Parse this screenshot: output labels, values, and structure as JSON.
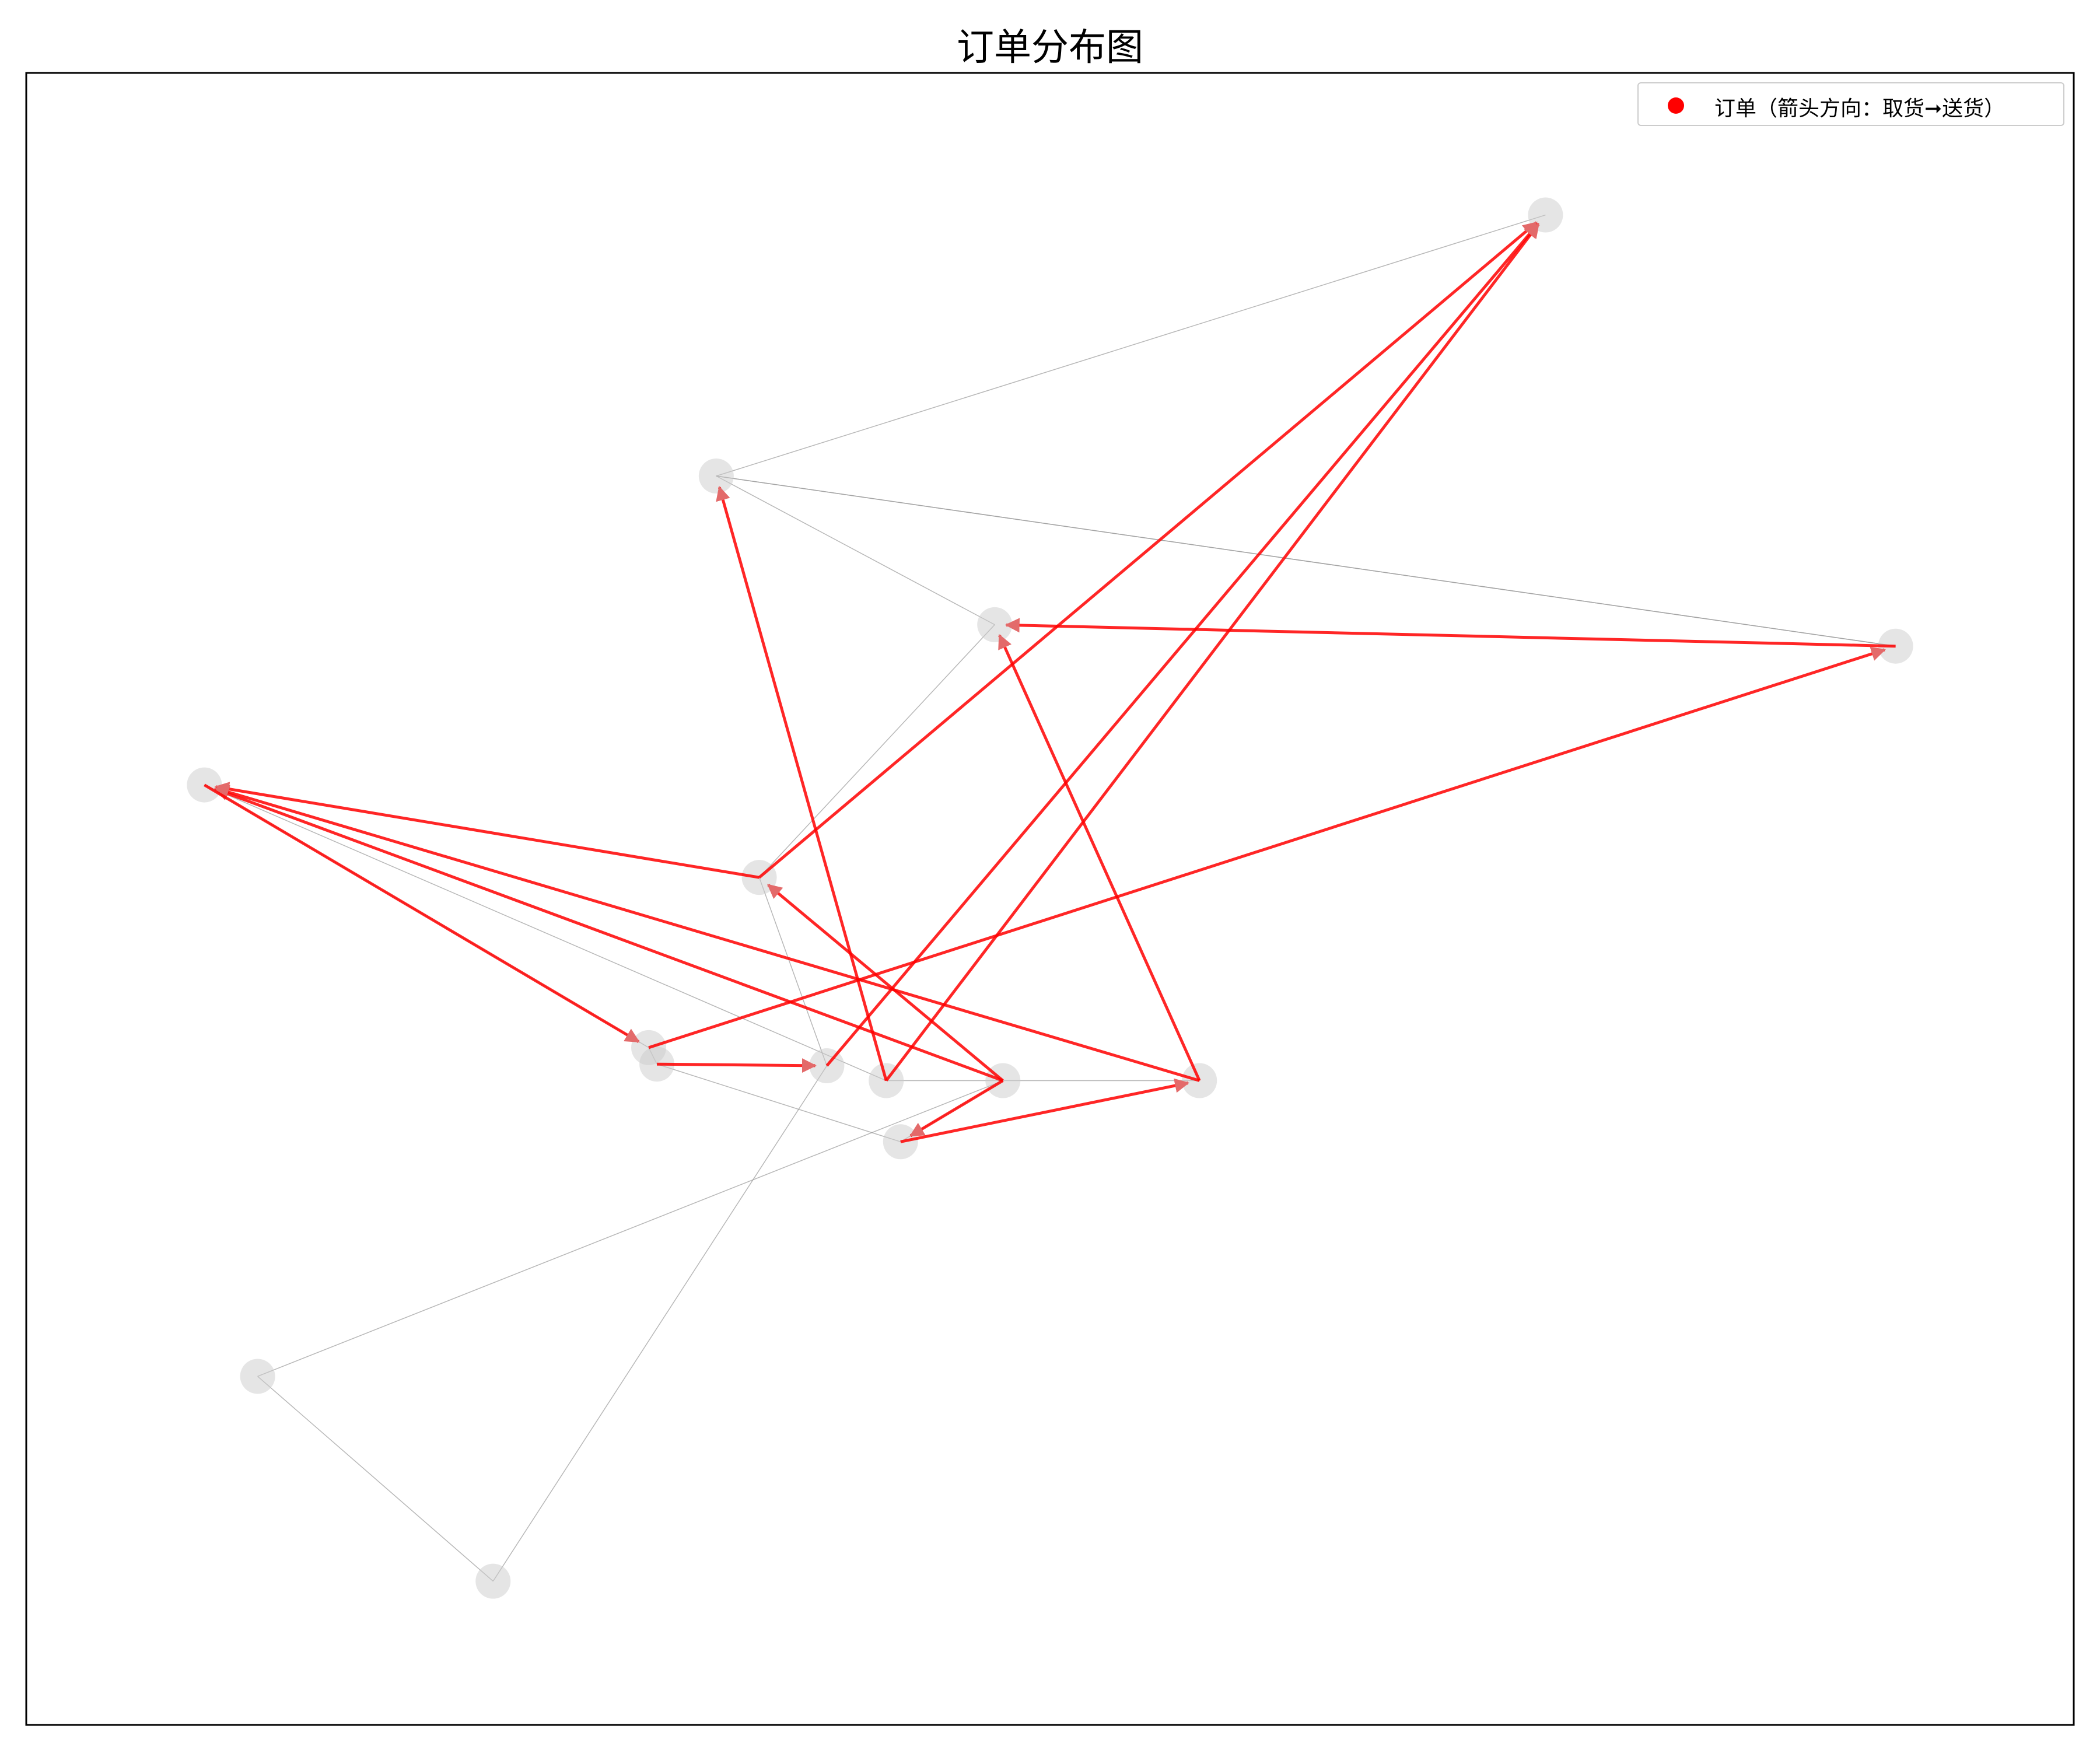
{
  "chart_data": {
    "type": "scatter",
    "title": "订单分布图",
    "xlabel": "",
    "ylabel": "",
    "xlim": [
      0,
      100
    ],
    "ylim": [
      0,
      100
    ],
    "grid": false,
    "axes_ticks": false,
    "legend": {
      "placement": "top-right",
      "label": "订单（箭头方向：取货➞送货）"
    },
    "colors": {
      "arrow": "#ff0000",
      "node": "#cccccc",
      "route": "#999999",
      "legend_marker": "#ff0000"
    },
    "nodes": [
      {
        "id": "A",
        "x": 74.2,
        "y": 91.4
      },
      {
        "id": "B",
        "x": 33.7,
        "y": 75.6
      },
      {
        "id": "C",
        "x": 47.3,
        "y": 66.6
      },
      {
        "id": "D",
        "x": 91.3,
        "y": 65.3
      },
      {
        "id": "E",
        "x": 8.7,
        "y": 56.9
      },
      {
        "id": "F",
        "x": 35.8,
        "y": 51.3
      },
      {
        "id": "G",
        "x": 30.4,
        "y": 41.0
      },
      {
        "id": "H",
        "x": 30.8,
        "y": 40.0
      },
      {
        "id": "I",
        "x": 39.1,
        "y": 39.9
      },
      {
        "id": "J",
        "x": 42.0,
        "y": 39.0
      },
      {
        "id": "K",
        "x": 47.7,
        "y": 39.0
      },
      {
        "id": "L",
        "x": 57.3,
        "y": 39.0
      },
      {
        "id": "M",
        "x": 42.7,
        "y": 35.3
      },
      {
        "id": "N",
        "x": 11.3,
        "y": 21.1
      },
      {
        "id": "O",
        "x": 22.8,
        "y": 8.7
      }
    ],
    "route": [
      "A",
      "B",
      "D",
      "B",
      "C",
      "F",
      "I",
      "O",
      "N",
      "K",
      "M",
      "H",
      "G",
      "E",
      "J",
      "K",
      "L"
    ],
    "orders": [
      {
        "pickup": "F",
        "dropoff": "A"
      },
      {
        "pickup": "I",
        "dropoff": "A"
      },
      {
        "pickup": "J",
        "dropoff": "A"
      },
      {
        "pickup": "J",
        "dropoff": "B"
      },
      {
        "pickup": "D",
        "dropoff": "C"
      },
      {
        "pickup": "L",
        "dropoff": "C"
      },
      {
        "pickup": "F",
        "dropoff": "E"
      },
      {
        "pickup": "K",
        "dropoff": "E"
      },
      {
        "pickup": "L",
        "dropoff": "E"
      },
      {
        "pickup": "G",
        "dropoff": "D"
      },
      {
        "pickup": "E",
        "dropoff": "G"
      },
      {
        "pickup": "H",
        "dropoff": "I"
      },
      {
        "pickup": "K",
        "dropoff": "F"
      },
      {
        "pickup": "K",
        "dropoff": "M"
      },
      {
        "pickup": "M",
        "dropoff": "L"
      }
    ]
  }
}
